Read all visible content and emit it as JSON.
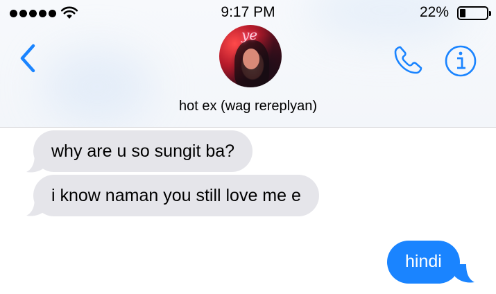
{
  "status_bar": {
    "time": "9:17 PM",
    "battery_percent": "22%",
    "signal_bars": 5,
    "battery_level": 0.22
  },
  "header": {
    "contact_name": "hot ex (wag rereplyan)",
    "avatar_neon_text": "ye",
    "icons": [
      "chevron-left-icon",
      "phone-icon",
      "info-icon"
    ]
  },
  "messages": [
    {
      "direction": "incoming",
      "text": "why are u so sungit ba?"
    },
    {
      "direction": "incoming",
      "text": "i know naman you still love me e"
    },
    {
      "direction": "outgoing",
      "text": "hindi"
    }
  ],
  "colors": {
    "accent": "#1a84ff",
    "incoming_bubble": "#e5e5ea",
    "outgoing_bubble": "#1a84ff",
    "header_bg": "#f4f7fb"
  }
}
